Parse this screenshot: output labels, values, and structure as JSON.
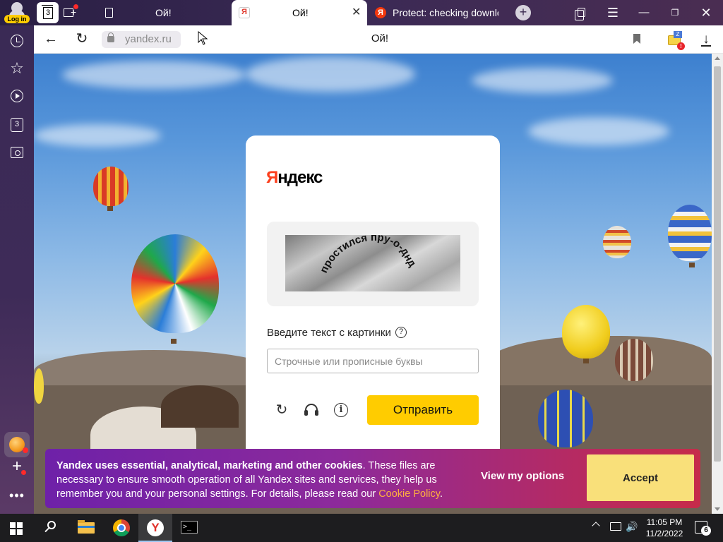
{
  "profile": {
    "login_label": "Log in"
  },
  "toolbar": {
    "tabs_count": "3"
  },
  "tabs": [
    {
      "label": "Ой!"
    },
    {
      "label": "Ой!",
      "favicon": "Я",
      "close": "✕"
    },
    {
      "label": "Protect: checking downlo",
      "favicon": "Я"
    }
  ],
  "window": {
    "new_tab": "+",
    "menu": "☰",
    "minimize": "—",
    "maximize": "❐",
    "close": "✕"
  },
  "sidebar": {
    "items": [
      {
        "name": "history-icon"
      },
      {
        "name": "star-icon",
        "glyph": "☆"
      },
      {
        "name": "play-icon"
      },
      {
        "name": "tabs-icon",
        "count": "3"
      },
      {
        "name": "screenshot-icon"
      }
    ],
    "add": "+",
    "more": "•••"
  },
  "address_bar": {
    "back": "←",
    "reload": "↻",
    "url": "yandex.ru",
    "page_title": "Ой!",
    "mail_badge": "!",
    "mail_label": "Z",
    "download": "↓"
  },
  "captcha": {
    "logo_first": "Я",
    "logo_rest": "ндекс",
    "image_text": "простился пру-о-днд",
    "prompt": "Введите текст с картинки",
    "help": "?",
    "input_value": "",
    "input_placeholder": "Строчные или прописные буквы",
    "refresh": "↻",
    "info": "i",
    "submit_label": "Отправить"
  },
  "cookie_banner": {
    "bold": "Yandex uses essential, analytical, marketing and other cookies",
    "body": ". These files are necessary to ensure smooth operation of all Yandex sites and services, they help us remember you and your personal settings. For details, please read our ",
    "link": "Cookie Policy",
    "end": ".",
    "options_label": "View my options",
    "accept_label": "Accept"
  },
  "taskbar": {
    "time": "11:05 PM",
    "date": "11/2/2022",
    "notifications": "6",
    "volume": "🔊",
    "terminal": ">_"
  },
  "colors": {
    "yandex_red": "#fc3f1d",
    "submit_yellow": "#ffcc00",
    "accept_yellow": "#f9e07a",
    "link_orange": "#ffb040",
    "tab_strip": "#3b2a55"
  }
}
